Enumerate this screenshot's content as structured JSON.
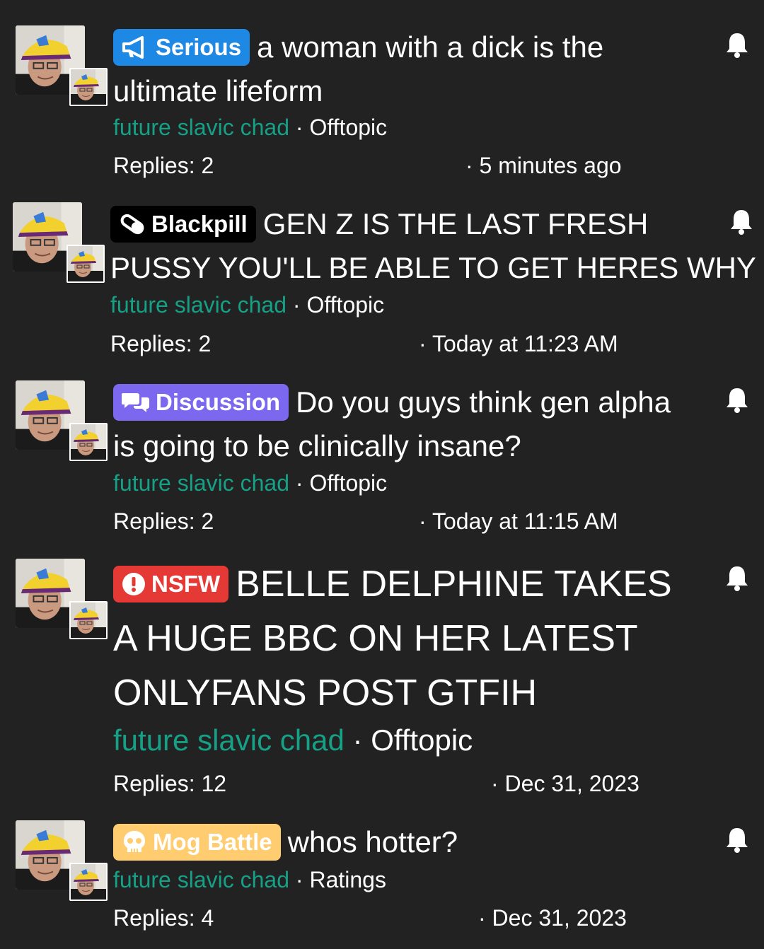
{
  "threads": [
    {
      "prefix": "Serious",
      "title_line1": "a woman with a dick is the",
      "title_line2": "ultimate lifeform",
      "author": "future slavic chad",
      "separator": "·",
      "forum": "Offtopic",
      "replies": "Replies: 2",
      "date": "· 5 minutes ago"
    },
    {
      "prefix": "Blackpill",
      "title_line1": "GEN Z IS THE LAST FRESH",
      "title_line2": "PUSSY YOU'LL BE ABLE TO GET HERES WHY",
      "author": "future slavic chad",
      "separator": "·",
      "forum": "Offtopic",
      "replies": "Replies: 2",
      "date": "· Today at 11:23 AM"
    },
    {
      "prefix": "Discussion",
      "title_line1": "Do you guys think gen alpha",
      "title_line2": "is going to be clinically insane?",
      "author": "future slavic chad",
      "separator": "·",
      "forum": "Offtopic",
      "replies": "Replies: 2",
      "date": "· Today at 11:15 AM"
    },
    {
      "prefix": "NSFW",
      "title_line1": "BELLE DELPHINE TAKES",
      "title_line2": "A HUGE BBC ON HER LATEST",
      "title_line3": "ONLYFANS POST GTFIH",
      "author": "future slavic chad",
      "separator": "·",
      "forum": "Offtopic",
      "replies": "Replies: 12",
      "date": "· Dec 31, 2023"
    },
    {
      "prefix": "Mog Battle",
      "title_line1": "whos hotter?",
      "author": "future slavic chad",
      "separator": "·",
      "forum": "Ratings",
      "replies": "Replies: 4",
      "date": "· Dec 31, 2023"
    }
  ],
  "icons": {
    "serious": "megaphone-icon",
    "blackpill": "pill-icon",
    "discussion": "chat-bubbles-icon",
    "nsfw": "exclamation-circle-icon",
    "mog": "skull-icon",
    "watch": "bell-icon"
  },
  "colors": {
    "background": "#222223",
    "author": "#16a085",
    "serious": "#1e88e5",
    "blackpill": "#000000",
    "discussion": "#7b68ee",
    "nsfw": "#e53935",
    "mog": "#ffcc70"
  }
}
